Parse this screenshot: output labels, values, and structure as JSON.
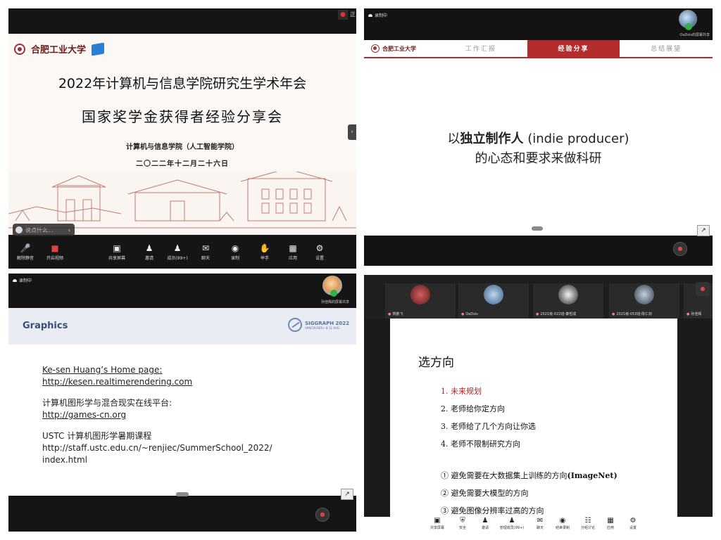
{
  "panel1": {
    "slide": {
      "university_name": "合肥工业大学",
      "title_line1": "2022年计算机与信息学院研究生学术年会",
      "title_line2": "国家奖学金获得者经验分享会",
      "school": "计算机与信息学院（人工智能学院）",
      "date": "二〇二二年十二月二十六日"
    },
    "chat_placeholder": "说点什么...",
    "toolbar": [
      {
        "label": "解除静音",
        "icon": "mic-muted-icon"
      },
      {
        "label": "开启视频",
        "icon": "video-off-icon"
      },
      {
        "label": "共享屏幕",
        "icon": "share-screen-icon"
      },
      {
        "label": "邀请",
        "icon": "invite-icon"
      },
      {
        "label": "成员(99+)",
        "icon": "members-icon"
      },
      {
        "label": "聊天",
        "icon": "chat-icon"
      },
      {
        "label": "录制",
        "icon": "record-icon"
      },
      {
        "label": "举手",
        "icon": "raise-hand-icon"
      },
      {
        "label": "应用",
        "icon": "apps-icon"
      },
      {
        "label": "设置",
        "icon": "settings-icon"
      }
    ]
  },
  "panel2": {
    "recording": "录制中",
    "share_label": "OaDsis的屏幕共享",
    "nav_tabs": [
      "工作汇报",
      "经验分享",
      "总结展望"
    ],
    "active_tab": 1,
    "line1_prefix": "以",
    "line1_bold": "独立制作人",
    "line1_suffix": " (indie producer)",
    "line2": "的心态和要求来做科研"
  },
  "panel3": {
    "recording": "录制中",
    "share_label": "孙佳辉的屏幕共享",
    "slide_title": "Graphics",
    "siggraph_title": "SIGGRAPH 2022",
    "siggraph_sub": "VANCOUVER+ 8-11 AUG",
    "items": [
      {
        "title": "Ke-sen Huang’s Home page:",
        "link": "http://kesen.realtimerendering.com"
      },
      {
        "title": "计算机图形学与混合现实在线平台:",
        "link": "http://games-cn.org"
      },
      {
        "title": "USTC 计算机图形学暑期课程",
        "link": "http://staff.ustc.edu.cn/~renjiec/SummerSchool_2022/",
        "link2": "index.html"
      }
    ]
  },
  "panel4": {
    "participants": [
      "贺鹏飞",
      "OaDsis",
      "2021级-022班-秦哲成",
      "2021级-053班-陈仁好",
      "孙佳辉"
    ],
    "title": "选方向",
    "list": [
      "1.  未来规划",
      "2.  老师给你定方向",
      "3.  老师给了几个方向让你选",
      "4.  老师不限制研究方向"
    ],
    "avoid": [
      {
        "text": "① 避免需要在大数据集上训练的方向",
        "bold": "(ImageNet)"
      },
      {
        "text": "② 避免需要大模型的方向",
        "bold": ""
      },
      {
        "text": "③ 避免图像分辨率过高的方向",
        "bold": ""
      }
    ],
    "toolbar": [
      "共享屏幕",
      "安全",
      "邀请",
      "管理成员(99+)",
      "聊天",
      "结束录制",
      "分组讨论",
      "应用",
      "设置"
    ]
  },
  "colors": {
    "hfut_red": "#b52c2c",
    "graphics_blue": "#3a4c7a",
    "list_red": "#c02020"
  }
}
